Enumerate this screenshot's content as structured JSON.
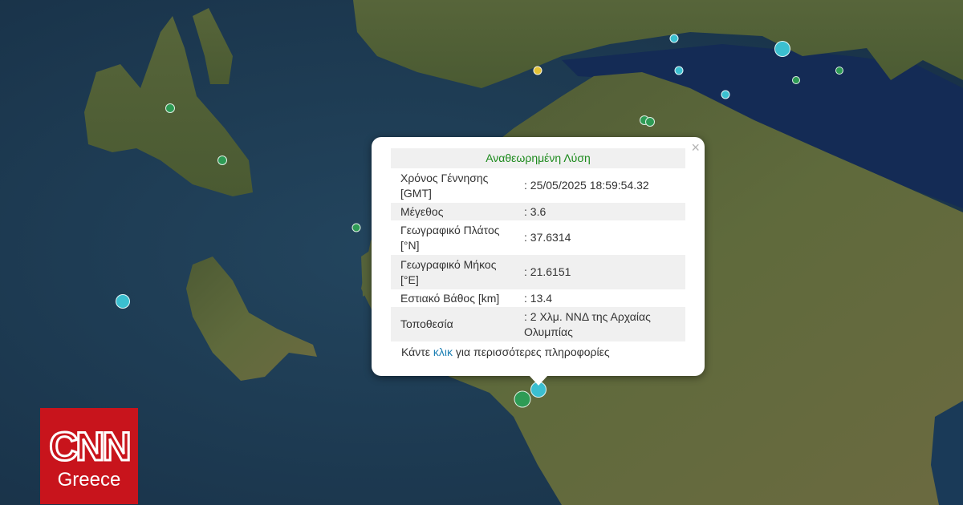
{
  "popup": {
    "close_symbol": "×",
    "header": "Αναθεωρημένη Λύση",
    "rows": [
      {
        "label": "Χρόνος Γέννησης [GMT]",
        "value": ": 25/05/2025 18:59:54.32"
      },
      {
        "label": "Μέγεθος",
        "value": ": 3.6"
      },
      {
        "label": "Γεωγραφικό Πλάτος [°N]",
        "value": ": 37.6314"
      },
      {
        "label": "Γεωγραφικό Μήκος [°E]",
        "value": ": 21.6151"
      },
      {
        "label": "Εστιακό Βάθος [km]",
        "value": ": 13.4"
      },
      {
        "label": "Τοποθεσία",
        "value": ": 2 Χλμ. ΝΝΔ της Αρχαίας Ολυμπίας"
      }
    ],
    "more_prefix": "Κάντε ",
    "more_link": "κλικ",
    "more_suffix": " για περισσότερες πληροφορίες"
  },
  "logo": {
    "brand": "CNN",
    "region": "Greece",
    "color": "#c8141c"
  },
  "quake_colors": {
    "recent": "#3bbfd0",
    "older": "#2e9b55",
    "yellow": "#e3c236"
  }
}
